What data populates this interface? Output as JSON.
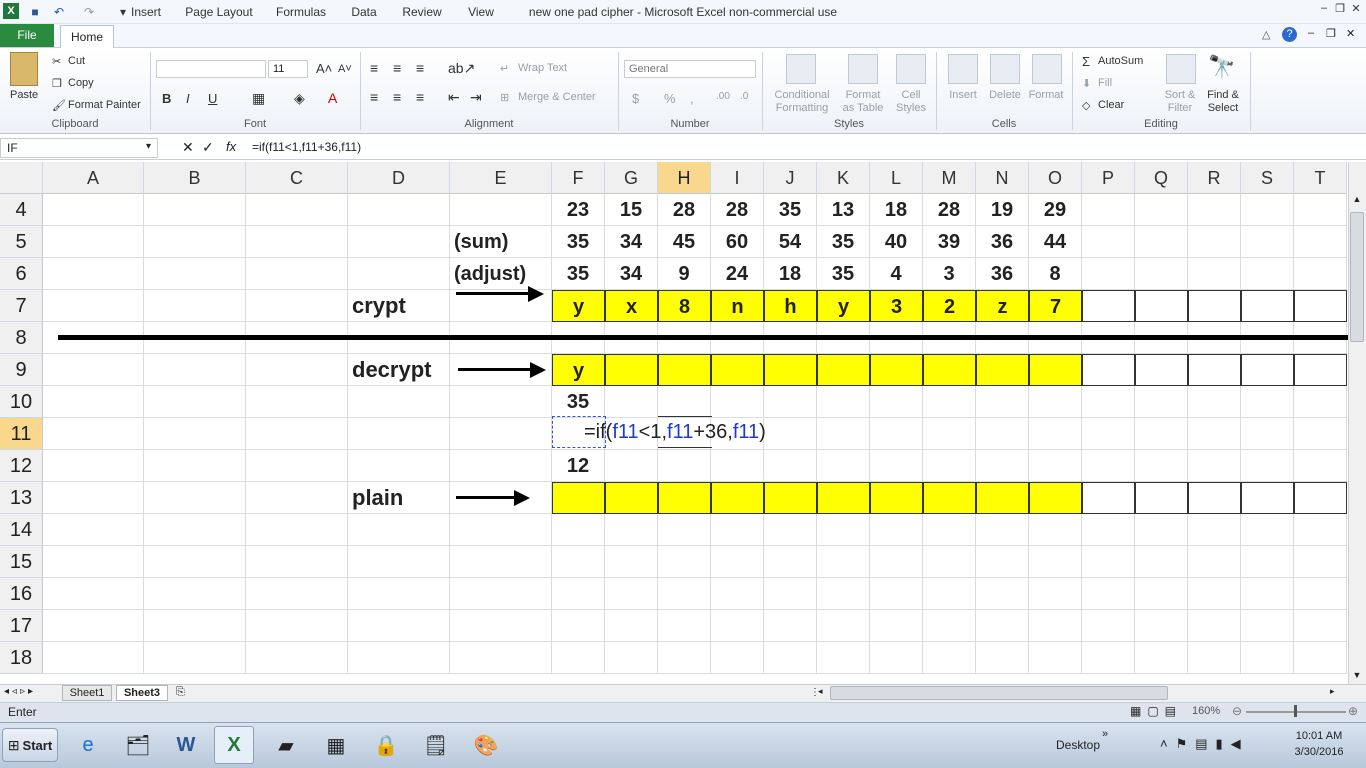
{
  "window": {
    "title": "new one pad cipher - Microsoft Excel non-commercial use"
  },
  "tabs": {
    "file": "File",
    "home": "Home",
    "others": [
      "Insert",
      "Page Layout",
      "Formulas",
      "Data",
      "Review",
      "View"
    ]
  },
  "ribbon": {
    "clipboard": {
      "paste": "Paste",
      "cut": "Cut",
      "copy": "Copy",
      "format_painter": "Format Painter",
      "label": "Clipboard"
    },
    "font": {
      "size": "11",
      "bold": "B",
      "italic": "I",
      "underline": "U",
      "label": "Font"
    },
    "alignment": {
      "wrap_text": "Wrap Text",
      "merge_center": "Merge & Center",
      "label": "Alignment"
    },
    "number": {
      "format": "General",
      "label": "Number"
    },
    "styles": {
      "conditional": "Conditional",
      "formatting": "Formatting",
      "format": "Format",
      "as_table": "as Table",
      "cell": "Cell",
      "styles": "Styles",
      "label": "Styles"
    },
    "cells": {
      "insert": "Insert",
      "delete": "Delete",
      "format": "Format",
      "label": "Cells"
    },
    "editing": {
      "autosum": "AutoSum",
      "fill": "Fill",
      "clear": "Clear",
      "sort": "Sort &",
      "filter": "Filter",
      "find": "Find &",
      "select": "Select",
      "label": "Editing"
    }
  },
  "formula_bar": {
    "name_box": "IF",
    "fx": "fx",
    "formula": "=if(f11<1,f11+36,f11)"
  },
  "columns": [
    "A",
    "B",
    "C",
    "D",
    "E",
    "F",
    "G",
    "H",
    "I",
    "J",
    "K",
    "L",
    "M",
    "N",
    "O",
    "P",
    "Q",
    "R",
    "S",
    "T"
  ],
  "rows": [
    "4",
    "5",
    "6",
    "7",
    "8",
    "9",
    "10",
    "11",
    "12",
    "13",
    "14",
    "15",
    "16",
    "17",
    "18"
  ],
  "sheet": {
    "row4": [
      "23",
      "15",
      "28",
      "28",
      "35",
      "13",
      "18",
      "28",
      "19",
      "29"
    ],
    "row5_label": "(sum)",
    "row5": [
      "35",
      "34",
      "45",
      "60",
      "54",
      "35",
      "40",
      "39",
      "36",
      "44"
    ],
    "row6_label": "(adjust)",
    "row6": [
      "35",
      "34",
      "9",
      "24",
      "18",
      "35",
      "4",
      "3",
      "36",
      "8"
    ],
    "crypt_label": "crypt",
    "row7": [
      "y",
      "x",
      "8",
      "n",
      "h",
      "y",
      "3",
      "2",
      "z",
      "7"
    ],
    "decrypt_label": "decrypt",
    "row9_f": "y",
    "row10_f": "35",
    "row11_edit": {
      "p1": "=if(",
      "r1": "f11",
      "p2": "<1,",
      "r2": "f11",
      "p3": "+36,",
      "r3": "f11",
      "p4": ")"
    },
    "row12_f": "12",
    "plain_label": "plain"
  },
  "sheet_tabs": [
    "Sheet1",
    "Sheet3"
  ],
  "status": {
    "mode": "Enter",
    "zoom": "160%"
  },
  "taskbar": {
    "start": "Start",
    "desktop": "Desktop",
    "time": "10:01 AM",
    "date": "3/30/2016"
  }
}
